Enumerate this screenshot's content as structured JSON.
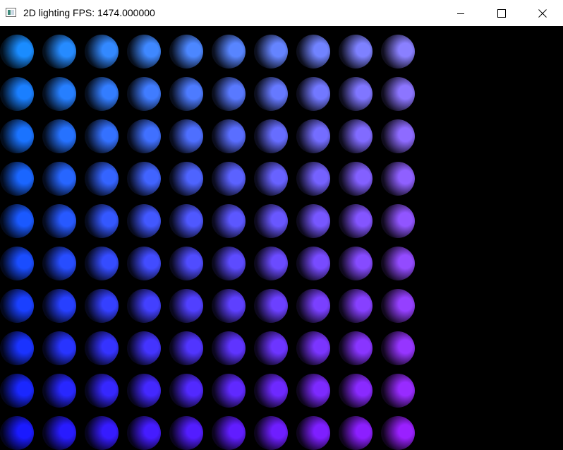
{
  "window": {
    "title": "2D lighting FPS: 1474.000000",
    "icon": "app-window-icon",
    "controls": {
      "minimize_icon": "minimize-icon",
      "maximize_icon": "maximize-icon",
      "close_icon": "close-icon"
    }
  },
  "scene": {
    "background": "#000000",
    "grid": {
      "rows": 10,
      "cols": 10
    },
    "color_corners": {
      "top_left": "#1a8cff",
      "top_right": "#8a80ff",
      "bottom_left": "#1a1aff",
      "bottom_right": "#9a20ff"
    }
  }
}
